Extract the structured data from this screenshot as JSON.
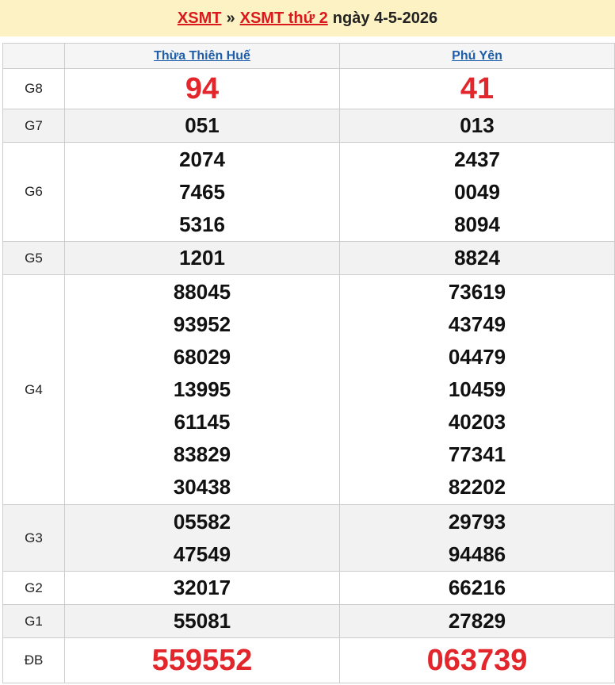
{
  "header": {
    "link_main": "XSMT",
    "separator": "»",
    "link_day": "XSMT thứ 2",
    "date_text": "ngày 4-5-2026"
  },
  "provinces": [
    "Thừa Thiên Huế",
    "Phú Yên"
  ],
  "prizes": [
    {
      "label": "G8",
      "values": [
        [
          "94"
        ],
        [
          "41"
        ]
      ]
    },
    {
      "label": "G7",
      "values": [
        [
          "051"
        ],
        [
          "013"
        ]
      ]
    },
    {
      "label": "G6",
      "values": [
        [
          "2074",
          "7465",
          "5316"
        ],
        [
          "2437",
          "0049",
          "8094"
        ]
      ]
    },
    {
      "label": "G5",
      "values": [
        [
          "1201"
        ],
        [
          "8824"
        ]
      ]
    },
    {
      "label": "G4",
      "values": [
        [
          "88045",
          "93952",
          "68029",
          "13995",
          "61145",
          "83829",
          "30438"
        ],
        [
          "73619",
          "43749",
          "04479",
          "10459",
          "40203",
          "77341",
          "82202"
        ]
      ]
    },
    {
      "label": "G3",
      "values": [
        [
          "05582",
          "47549"
        ],
        [
          "29793",
          "94486"
        ]
      ]
    },
    {
      "label": "G2",
      "values": [
        [
          "32017"
        ],
        [
          "66216"
        ]
      ]
    },
    {
      "label": "G1",
      "values": [
        [
          "55081"
        ],
        [
          "27829"
        ]
      ]
    },
    {
      "label": "ĐB",
      "values": [
        [
          "559552"
        ],
        [
          "063739"
        ]
      ]
    }
  ],
  "colors": {
    "header_bg": "#fcf2c4",
    "link_red": "#d9191c",
    "province_link": "#1f5ea8",
    "highlight_red": "#e3262b",
    "alt_row_bg": "#f2f2f2"
  }
}
